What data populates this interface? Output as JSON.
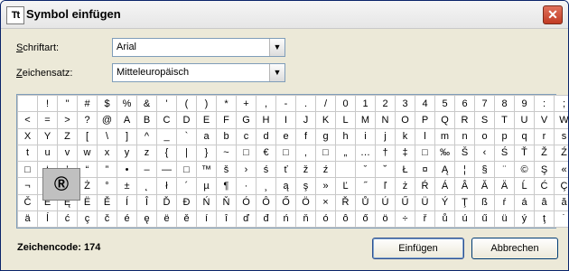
{
  "window": {
    "icon_text": "Tt",
    "title": "Symbol einfügen",
    "close_label": "✕"
  },
  "form": {
    "font_label_underline": "S",
    "font_label_rest": "chriftart:",
    "font_value": "Arial",
    "charset_label_underline": "Z",
    "charset_label_rest": "eichensatz:",
    "charset_value": "Mitteleuropäisch",
    "arrow": "▼"
  },
  "grid": {
    "rows": [
      [
        " ",
        "!",
        "\"",
        "#",
        "$",
        "%",
        "&",
        "'",
        "(",
        ")",
        "*",
        "+",
        ",",
        "-",
        ".",
        "/",
        "0",
        "1",
        "2",
        "3",
        "4",
        "5",
        "6",
        "7",
        "8",
        "9",
        ":",
        ";"
      ],
      [
        "<",
        "=",
        ">",
        "?",
        "@",
        "A",
        "B",
        "C",
        "D",
        "E",
        "F",
        "G",
        "H",
        "I",
        "J",
        "K",
        "L",
        "M",
        "N",
        "O",
        "P",
        "Q",
        "R",
        "S",
        "T",
        "U",
        "V",
        "W"
      ],
      [
        "X",
        "Y",
        "Z",
        "[",
        "\\",
        "]",
        "^",
        "_",
        "`",
        "a",
        "b",
        "c",
        "d",
        "e",
        "f",
        "g",
        "h",
        "i",
        "j",
        "k",
        "l",
        "m",
        "n",
        "o",
        "p",
        "q",
        "r",
        "s"
      ],
      [
        "t",
        "u",
        "v",
        "w",
        "x",
        "y",
        "z",
        "{",
        "|",
        "}",
        "~",
        "□",
        "€",
        "□",
        "‚",
        "□",
        "„",
        "…",
        "†",
        "‡",
        "□",
        "‰",
        "Š",
        "‹",
        "Ś",
        "Ť",
        "Ž",
        "Ź"
      ],
      [
        "□",
        "‘",
        "’",
        "“",
        "”",
        "•",
        "–",
        "—",
        "□",
        "™",
        "š",
        "›",
        "ś",
        "ť",
        "ž",
        "ź",
        " ",
        "ˇ",
        "˘",
        "Ł",
        "¤",
        "Ą",
        "¦",
        "§",
        "¨",
        "©",
        "Ş",
        "«"
      ],
      [
        "¬",
        "­",
        "®",
        "Ż",
        "°",
        "±",
        "˛",
        "ł",
        "´",
        "µ",
        "¶",
        "·",
        "¸",
        "ą",
        "ş",
        "»",
        "Ľ",
        "˝",
        "ľ",
        "ż",
        "Ŕ",
        "Á",
        "Â",
        "Ă",
        "Ä",
        "Ĺ",
        "Ć",
        "Ç"
      ],
      [
        "Č",
        "É",
        "Ę",
        "Ë",
        "Ě",
        "Í",
        "Î",
        "Ď",
        "Đ",
        "Ń",
        "Ň",
        "Ó",
        "Ô",
        "Ő",
        "Ö",
        "×",
        "Ř",
        "Ů",
        "Ú",
        "Ű",
        "Ü",
        "Ý",
        "Ţ",
        "ß",
        "ŕ",
        "á",
        "â",
        "ă"
      ],
      [
        "ä",
        "ĺ",
        "ć",
        "ç",
        "č",
        "é",
        "ę",
        "ë",
        "ě",
        "í",
        "î",
        "ď",
        "đ",
        "ń",
        "ň",
        "ó",
        "ô",
        "ő",
        "ö",
        "÷",
        "ř",
        "ů",
        "ú",
        "ű",
        "ü",
        "ý",
        "ţ",
        "˙"
      ]
    ],
    "selected_row": 5,
    "selected_col": 2,
    "magnified_char": "®"
  },
  "footer": {
    "charcode_label": "Zeichencode: 174",
    "insert_button": "Einfügen",
    "cancel_button": "Abbrechen"
  }
}
